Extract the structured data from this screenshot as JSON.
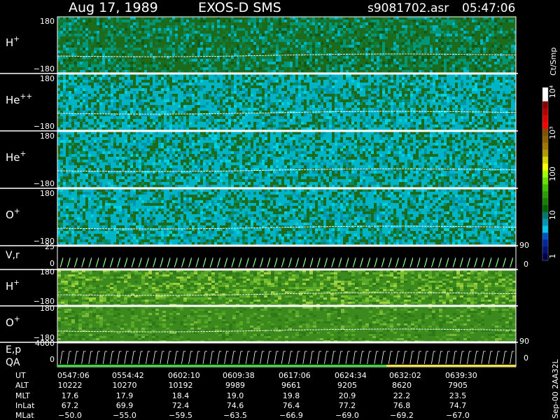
{
  "header": {
    "date": "Aug 17, 1989",
    "instrument": "EXOS-D SMS",
    "file": "s9081702.asr",
    "time": "05:47:06"
  },
  "colorbar": {
    "unit_label": "Ct/Smp",
    "tick_labels": [
      "10⁴",
      "10³",
      "100",
      "10",
      "1"
    ],
    "tick_values": [
      10000,
      1000,
      100,
      10,
      1
    ],
    "colors": [
      "#ffffff",
      "#ffffff",
      "#8a0000",
      "#b80000",
      "#e00000",
      "#ff0000",
      "#805000",
      "#8c6200",
      "#a07800",
      "#b49a00",
      "#d6d600",
      "#ffff00",
      "#a0ff00",
      "#6ae000",
      "#3cc000",
      "#2aa000",
      "#1a8000",
      "#006400",
      "#00786e",
      "#0096b4",
      "#00c8e6",
      "#0050c8",
      "#0028a0",
      "#001478",
      "#00004a"
    ]
  },
  "panels": [
    {
      "id": "h-plus",
      "label": "H",
      "sup": "+",
      "ymax": "180",
      "ymin": "−180",
      "palette": "h"
    },
    {
      "id": "he-plus-plus",
      "label": "He",
      "sup": "++",
      "ymax": "180",
      "ymin": "−180",
      "palette": "cyan"
    },
    {
      "id": "he-plus",
      "label": "He",
      "sup": "+",
      "ymax": "180",
      "ymin": "−180",
      "palette": "cyan"
    },
    {
      "id": "o-plus",
      "label": "O",
      "sup": "+",
      "ymax": "180",
      "ymin": "−180",
      "palette": "cyan"
    }
  ],
  "vr_panel": {
    "label": "V,r",
    "ymax": "25",
    "ymin": "0",
    "right_max": "90",
    "right_min": "0"
  },
  "lower_panels": [
    {
      "id": "h-plus-low",
      "label": "H",
      "sup": "+",
      "ymax": "180",
      "ymin": "−180"
    },
    {
      "id": "o-plus-low",
      "label": "O",
      "sup": "+",
      "ymax": "180",
      "ymin": "−180"
    }
  ],
  "ep_panel": {
    "label1": "E,p",
    "label2": "QA",
    "ymax": "4000",
    "ymin": "0",
    "right_max": "90",
    "right_min": "0"
  },
  "footer_tag": "Sep-00 2AA32L",
  "orbit_table": {
    "row_labels": [
      "UT",
      "ALT",
      "MLT",
      "InLat",
      "MLat"
    ],
    "columns": [
      [
        "0547:06",
        "10222",
        "17.6",
        "67.2",
        "−50.0"
      ],
      [
        "0554:42",
        "10270",
        "17.9",
        "69.9",
        "−55.0"
      ],
      [
        "0602:10",
        "10192",
        "18.4",
        "72.4",
        "−59.5"
      ],
      [
        "0609:38",
        "9989",
        "19.0",
        "74.6",
        "−63.5"
      ],
      [
        "0617:06",
        "9661",
        "19.8",
        "76.4",
        "−66.9"
      ],
      [
        "0624:34",
        "9205",
        "20.9",
        "77.2",
        "−69.0"
      ],
      [
        "0632:02",
        "8620",
        "22.2",
        "76.8",
        "−69.2"
      ],
      [
        "0639:30",
        "7905",
        "23.5",
        "74.7",
        "−67.0"
      ]
    ]
  },
  "chart_data": {
    "type": "heatmap",
    "title": "Aug 17, 1989 EXOS-D SMS",
    "x": [
      "0547:06",
      "0554:42",
      "0602:10",
      "0609:38",
      "0617:06",
      "0624:34",
      "0632:02",
      "0639:30"
    ],
    "series": [
      {
        "name": "H+",
        "ylim": [
          -180,
          180
        ]
      },
      {
        "name": "He++",
        "ylim": [
          -180,
          180
        ]
      },
      {
        "name": "He+",
        "ylim": [
          -180,
          180
        ]
      },
      {
        "name": "O+",
        "ylim": [
          -180,
          180
        ]
      },
      {
        "name": "V,r",
        "ylim": [
          0,
          25
        ]
      },
      {
        "name": "H+",
        "ylim": [
          -180,
          180
        ]
      },
      {
        "name": "O+",
        "ylim": [
          -180,
          180
        ]
      },
      {
        "name": "E,p",
        "ylim": [
          0,
          4000
        ]
      }
    ],
    "colorbar_range": [
      1,
      10000
    ],
    "colorbar_scale": "log"
  }
}
